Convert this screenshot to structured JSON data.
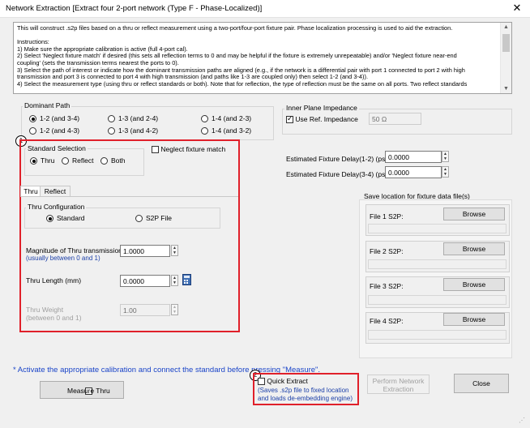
{
  "window": {
    "title": "Network Extraction [Extract four 2-port network (Type F - Phase-Localized)]",
    "close_glyph": "✕"
  },
  "instructions": {
    "lines": [
      "This will construct .s2p files based on a thru or reflect measurement using a two-port/four-port fixture pair.  Phase localization processing is used to aid the extraction.",
      "",
      "Instructions:",
      "1) Make sure the appropriate calibration is active (full 4-port cal).",
      "2) Select 'Neglect fixture match' if desired (this sets all reflection terms to 0 and may be helpful if the fixture is extremely unrepeatable) and/or 'Neglect fixture near-end",
      "coupling' (sets the transmission terms nearest the ports to 0).",
      "3) Select the path of interest or indicate how the dominant transmission paths are aligned (e.g., if the network is a differential pair with port 1 connected to port 2 with high",
      "transmission and port 3 is connected to port 4 with high transmission (and paths like 1-3 are coupled only) then select 1-2 (and 3-4)).",
      "4) Select the measurement type (using thru or reflect standards or both).  Note that for reflection, the type of reflection must be the same on all ports.  Two reflect standards"
    ]
  },
  "dominant_path": {
    "label": "Dominant Path",
    "options": [
      {
        "label": "1-2  (and 3-4)",
        "selected": true
      },
      {
        "label": "1-3 (and 2-4)",
        "selected": false
      },
      {
        "label": "1-4 (and 2-3)",
        "selected": false
      },
      {
        "label": "1-2  (and 4-3)",
        "selected": false
      },
      {
        "label": "1-3 (and 4-2)",
        "selected": false
      },
      {
        "label": "1-4 (and 3-2)",
        "selected": false
      }
    ]
  },
  "inner_plane": {
    "label": "Inner Plane Impedance",
    "use_ref_label": "Use Ref. Impedance",
    "use_ref_checked": true,
    "impedance_value": "50 Ω"
  },
  "callouts": {
    "one": "1",
    "two": "2"
  },
  "standard_selection": {
    "label": "Standard Selection",
    "options": [
      {
        "label": "Thru",
        "selected": true
      },
      {
        "label": "Reflect",
        "selected": false
      },
      {
        "label": "Both",
        "selected": false
      }
    ]
  },
  "neglect_match": {
    "label": "Neglect fixture match",
    "checked": false
  },
  "delays": {
    "d12_label": "Estimated Fixture Delay(1-2) (ps)",
    "d12_value": "0.0000",
    "d34_label": "Estimated Fixture Delay(3-4) (ps)",
    "d34_value": "0.0000"
  },
  "tabs": [
    {
      "label": "Thru",
      "selected": true
    },
    {
      "label": "Reflect",
      "selected": false
    }
  ],
  "thru_config": {
    "label": "Thru Configuration",
    "options": [
      {
        "label": "Standard",
        "selected": true
      },
      {
        "label": "S2P File",
        "selected": false
      }
    ]
  },
  "thru_fields": {
    "magnitude_label": "Magnitude of Thru transmission",
    "magnitude_hint": "(usually between 0 and 1)",
    "magnitude_value": "1.0000",
    "length_label": "Thru Length (mm)",
    "length_value": "0.0000",
    "weight_label": "Thru Weight",
    "weight_hint": "(between 0 and 1)",
    "weight_value": "1.00"
  },
  "save_location": {
    "label": "Save location for fixture data file(s)",
    "files": [
      {
        "label": "File 1 S2P:",
        "button": "Browse"
      },
      {
        "label": "File 2 S2P:",
        "button": "Browse"
      },
      {
        "label": "File 3 S2P:",
        "button": "Browse"
      },
      {
        "label": "File 4 S2P:",
        "button": "Browse"
      }
    ]
  },
  "activate_message": "* Activate the appropriate calibration and connect the standard before pressing \"Measure\".",
  "measure_button": "Measure Thru",
  "quick_extract": {
    "label": "Quick Extract",
    "checked": false,
    "note_line1": "(Saves .s2p file to fixed location",
    "note_line2": "and loads de-embedding engine)"
  },
  "perform_button": {
    "line1": "Perform Network",
    "line2": "Extraction"
  },
  "close_button": "Close",
  "colors": {
    "callout_red": "#e0202a",
    "hint_blue": "#1b3fa8",
    "message_blue": "#1a44c8"
  }
}
